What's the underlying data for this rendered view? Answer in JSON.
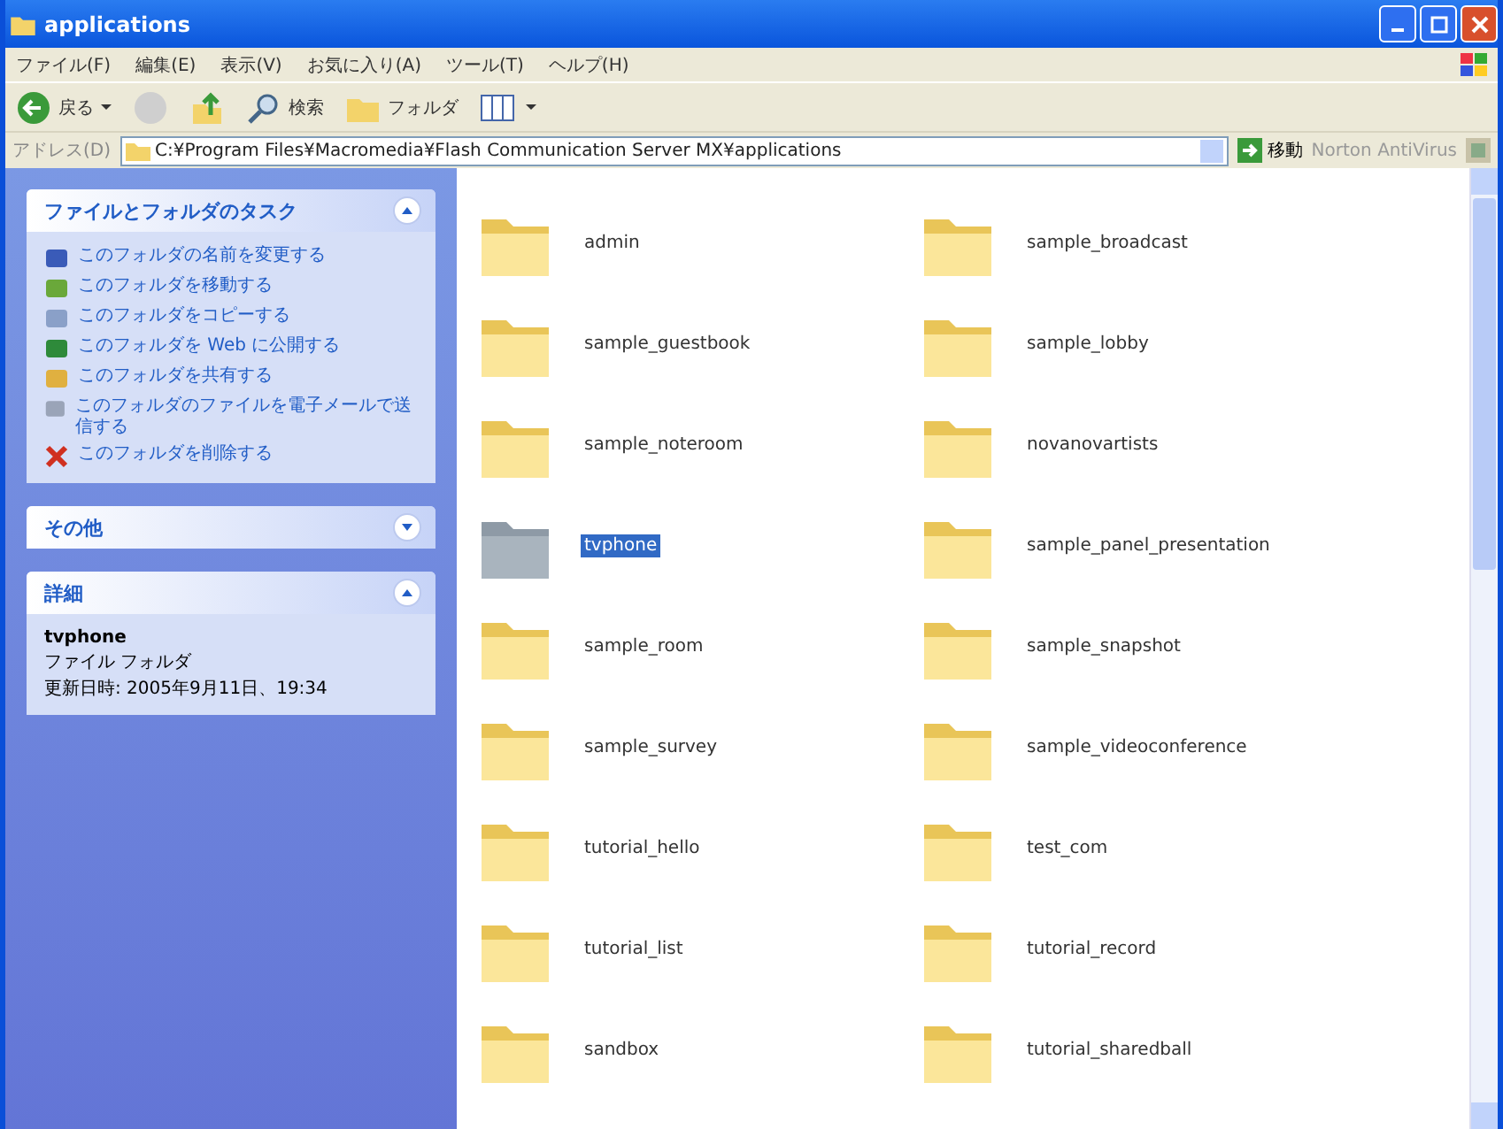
{
  "window": {
    "title": "applications"
  },
  "menu": [
    "ファイル(F)",
    "編集(E)",
    "表示(V)",
    "お気に入り(A)",
    "ツール(T)",
    "ヘルプ(H)"
  ],
  "toolbar": {
    "back": "戻る",
    "search": "検索",
    "folders": "フォルダ"
  },
  "address": {
    "label": "アドレス(D)",
    "value": "C:¥Program Files¥Macromedia¥Flash Communication Server MX¥applications",
    "go": "移動",
    "links": "Norton AntiVirus"
  },
  "tasks": {
    "title": "ファイルとフォルダのタスク",
    "items": [
      "このフォルダの名前を変更する",
      "このフォルダを移動する",
      "このフォルダをコピーする",
      "このフォルダを Web に公開する",
      "このフォルダを共有する",
      "このフォルダのファイルを電子メールで送信する",
      "このフォルダを削除する"
    ]
  },
  "other": {
    "title": "その他"
  },
  "details": {
    "title": "詳細",
    "name": "tvphone",
    "type": "ファイル フォルダ",
    "modified": "更新日時: 2005年9月11日、19:34"
  },
  "folders": [
    {
      "name": "admin",
      "selected": false
    },
    {
      "name": "sample_broadcast",
      "selected": false
    },
    {
      "name": "sample_guestbook",
      "selected": false
    },
    {
      "name": "sample_lobby",
      "selected": false
    },
    {
      "name": "sample_noteroom",
      "selected": false
    },
    {
      "name": "novanovartists",
      "selected": false
    },
    {
      "name": "tvphone",
      "selected": true
    },
    {
      "name": "sample_panel_presentation",
      "selected": false
    },
    {
      "name": "sample_room",
      "selected": false
    },
    {
      "name": "sample_snapshot",
      "selected": false
    },
    {
      "name": "sample_survey",
      "selected": false
    },
    {
      "name": "sample_videoconference",
      "selected": false
    },
    {
      "name": "tutorial_hello",
      "selected": false
    },
    {
      "name": "test_com",
      "selected": false
    },
    {
      "name": "tutorial_list",
      "selected": false
    },
    {
      "name": "tutorial_record",
      "selected": false
    },
    {
      "name": "sandbox",
      "selected": false
    },
    {
      "name": "tutorial_sharedball",
      "selected": false
    }
  ]
}
